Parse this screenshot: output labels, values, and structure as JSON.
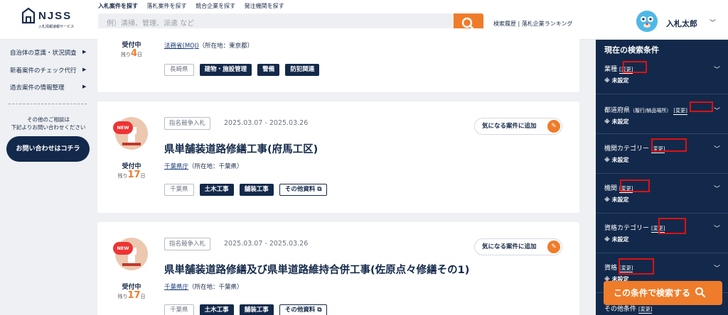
{
  "header": {
    "logo_text": "NJSS",
    "logo_sub": "入札情報速報サービス",
    "nav": [
      "入札案件を探す",
      "落札案件を探す",
      "競合企業を探す",
      "発注機関を探す"
    ],
    "search_placeholder": "例）清掃、管理、派遣 など",
    "links": "検索履歴 | 落札企業ランキング",
    "user_name": "入札太郎"
  },
  "sidebar": {
    "items": [
      {
        "label": "自治体の意識・状況調査"
      },
      {
        "label": "新着案件のチェック代行"
      },
      {
        "label": "過去案件の情報整理"
      }
    ],
    "consult_line1": "その他のご相談は",
    "consult_line2": "下記よりお問い合わせください",
    "contact_label": "お問い合わせはコチラ"
  },
  "cards": [
    {
      "status": "受付中",
      "remain_prefix": "残り",
      "remain_days": "4",
      "remain_suffix": "日",
      "org_link": "法務省(MOJ)",
      "org_loc": "（所在地：東京都）",
      "pref": "長崎県",
      "tags": [
        "建物・施設管理",
        "警備",
        "防犯関連"
      ]
    },
    {
      "new": "NEW",
      "type": "指名競争入札",
      "date": "2025.03.07 - 2025.03.26",
      "fav": "気になる案件に追加",
      "title": "県単舗装道路修繕工事(府馬工区)",
      "status": "受付中",
      "remain_prefix": "残り",
      "remain_days": "17",
      "remain_suffix": "日",
      "org_link": "千葉県庁",
      "org_loc": "（所在地：千葉県）",
      "pref": "千葉県",
      "tags": [
        "土木工事",
        "舗装工事"
      ],
      "doc": "その他資料"
    },
    {
      "new": "NEW",
      "type": "指名競争入札",
      "date": "2025.03.07 - 2025.03.26",
      "fav": "気になる案件に追加",
      "title": "県単舗装道路修繕及び県単道路維持合併工事(佐原点々修繕その1)",
      "status": "受付中",
      "remain_prefix": "残り",
      "remain_days": "17",
      "remain_suffix": "日",
      "org_link": "千葉県庁",
      "org_loc": "（所在地：千葉県）",
      "pref": "千葉県",
      "tags": [
        "土木工事",
        "舗装工事"
      ],
      "doc": "その他資料"
    }
  ],
  "panel": {
    "title": "現在の検索条件",
    "change_label": "[変更]",
    "unset": "※ 未設定",
    "conditions": [
      {
        "label": "業種"
      },
      {
        "label": "都道府県",
        "small": "（履行/納品場所）"
      },
      {
        "label": "機関カテゴリー"
      },
      {
        "label": "機関"
      },
      {
        "label": "資格カテゴリー"
      },
      {
        "label": "資格"
      },
      {
        "label": "その他条件"
      }
    ],
    "search_button": "この条件で検索する"
  },
  "colors": {
    "navy": "#13294b",
    "orange": "#ef7c2a",
    "highlight_red": "#e01010"
  }
}
